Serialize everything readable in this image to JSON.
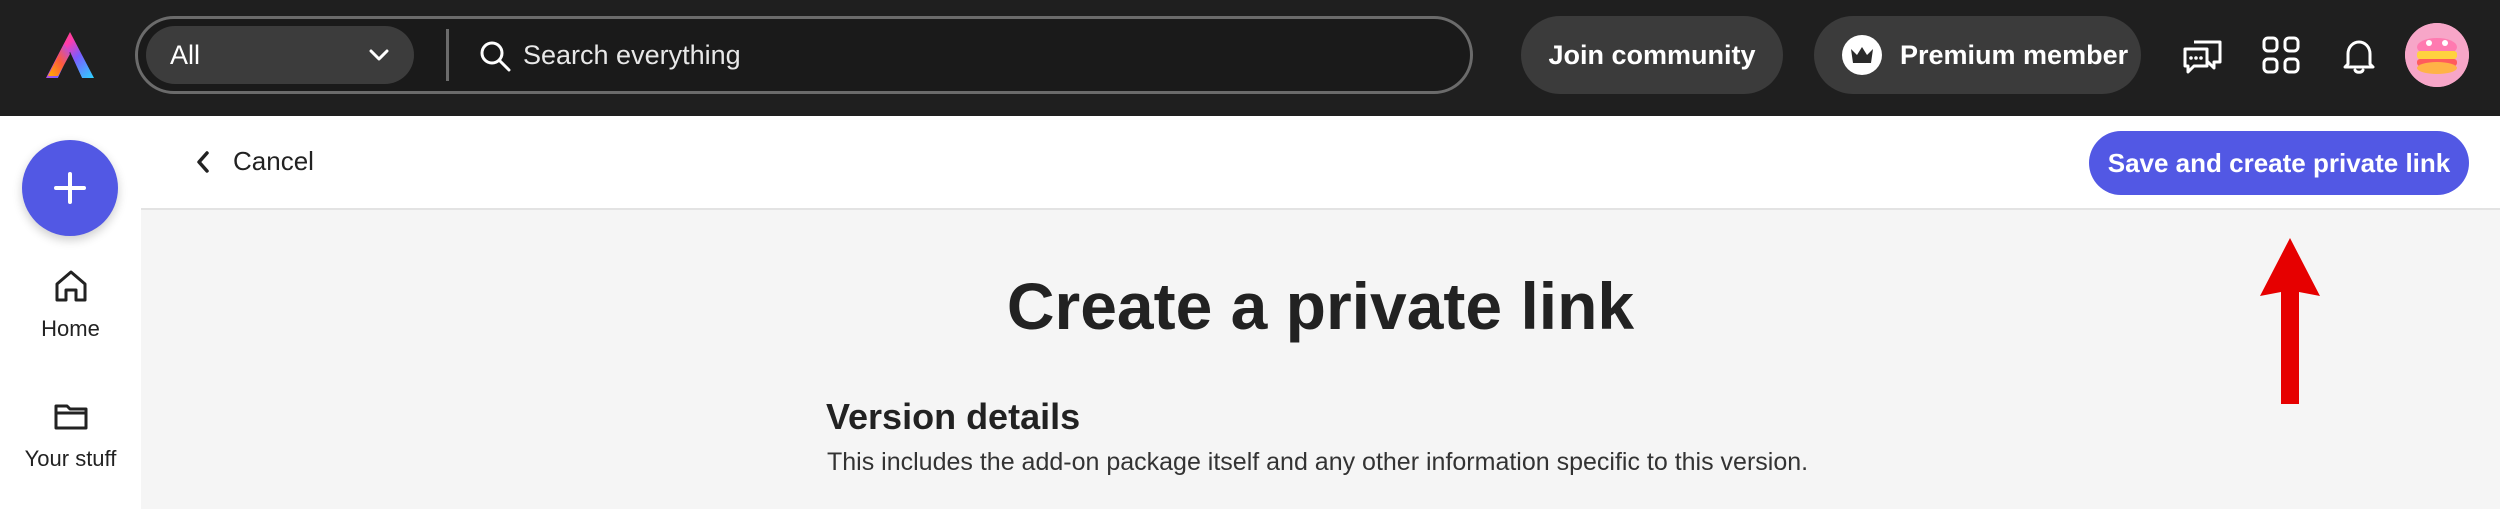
{
  "topbar": {
    "search_scope": "All",
    "search_placeholder": "Search everything",
    "join_label": "Join community",
    "premium_label": "Premium member"
  },
  "rail": {
    "items": [
      {
        "label": "Home",
        "icon": "home-icon"
      },
      {
        "label": "Your stuff",
        "icon": "folder-icon"
      }
    ]
  },
  "actionbar": {
    "cancel_label": "Cancel",
    "primary_label": "Save and create private link"
  },
  "main": {
    "title": "Create a private link",
    "section_title": "Version details",
    "section_desc": "This includes the add-on package itself and any other information specific to this version."
  },
  "colors": {
    "accent": "#5258e4",
    "topbar": "#1f1f1f",
    "annotation_arrow": "#e60000"
  }
}
